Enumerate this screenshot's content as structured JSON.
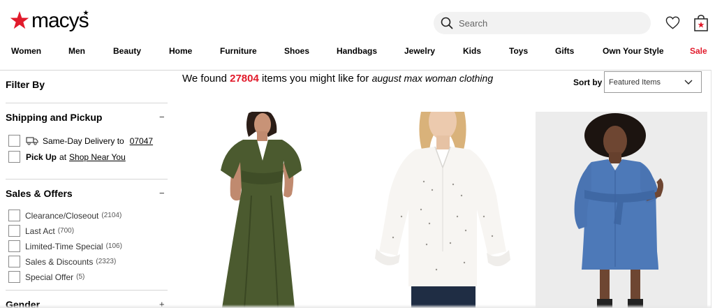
{
  "header": {
    "logo_text": "macys",
    "search": {
      "placeholder": "Search"
    },
    "brand_color": "#e11a2b"
  },
  "nav": {
    "items": [
      "Women",
      "Men",
      "Beauty",
      "Home",
      "Furniture",
      "Shoes",
      "Handbags",
      "Jewelry",
      "Kids",
      "Toys",
      "Gifts",
      "Own Your Style",
      "Sale"
    ]
  },
  "sidebar": {
    "filter_title": "Filter By",
    "shipping": {
      "title": "Shipping and Pickup",
      "toggle": "−",
      "same_day_label": "Same-Day Delivery to",
      "zip": "07047",
      "pickup_label": "Pick Up",
      "pickup_at": "at",
      "pickup_store": "Shop Near You"
    },
    "sales": {
      "title": "Sales & Offers",
      "toggle": "−",
      "options": [
        {
          "label": "Clearance/Closeout",
          "count": "(2104)"
        },
        {
          "label": "Last Act",
          "count": "(700)"
        },
        {
          "label": "Limited-Time Special",
          "count": "(106)"
        },
        {
          "label": "Sales & Discounts",
          "count": "(2323)"
        },
        {
          "label": "Special Offer",
          "count": "(5)"
        }
      ]
    },
    "gender": {
      "title": "Gender",
      "toggle": "+"
    }
  },
  "results": {
    "prefix": "We found",
    "count": "27804",
    "middle": "items you might like for",
    "query": "august max woman clothing"
  },
  "sort": {
    "label": "Sort by",
    "selected": "Featured Items"
  },
  "products": [
    {
      "image": "green-maxi-dress"
    },
    {
      "image": "white-dot-blouse"
    },
    {
      "image": "denim-shirt-dress"
    }
  ]
}
